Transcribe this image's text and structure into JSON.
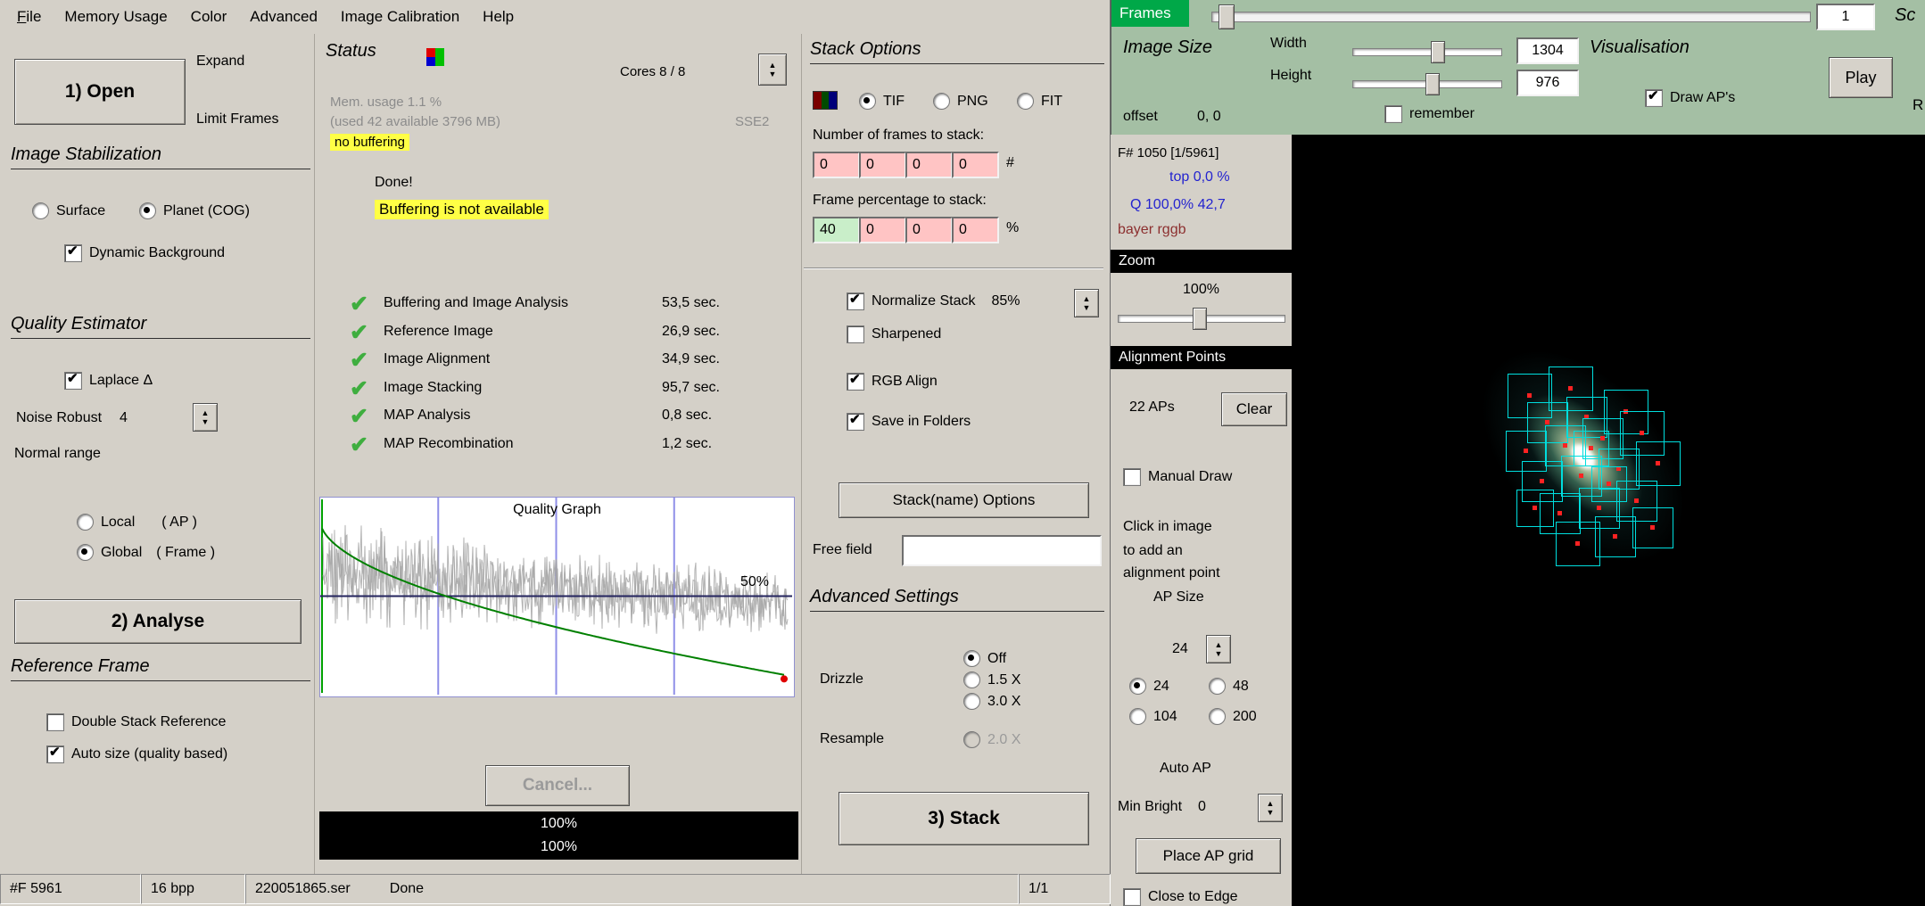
{
  "colors": {
    "window_bg": "#d4d0c8",
    "viewer_header_green": "#a4bfa4",
    "frames_badge_green": "#00a848",
    "highlight_yellow": "#ffff45",
    "info_blue": "#2323cf",
    "bayer_red": "#8c2f2f",
    "ap_box_cyan": "#00dede",
    "ap_dot_red": "#ff2222"
  },
  "menu": {
    "items": [
      "File",
      "Memory Usage",
      "Color",
      "Advanced",
      "Image Calibration",
      "Help"
    ]
  },
  "left": {
    "open": "1) Open",
    "expand": "Expand",
    "limit": "Limit Frames",
    "stab_title": "Image Stabilization",
    "surface": "Surface",
    "planet": "Planet (COG)",
    "dyn_bg": "Dynamic Background",
    "qe_title": "Quality Estimator",
    "laplace": "Laplace Δ",
    "noise_label": "Noise Robust",
    "noise_value": "4",
    "normal_range": "Normal range",
    "local": "Local",
    "local_sub": "( AP )",
    "global": "Global",
    "global_sub": "( Frame )",
    "analyse": "2) Analyse",
    "ref_title": "Reference Frame",
    "double_stack": "Double Stack Reference",
    "auto_size": "Auto size (quality based)"
  },
  "status": {
    "title": "Status",
    "cores": "Cores 8 / 8",
    "mem": "Mem. usage 1.1 %",
    "mem2": "(used 42 available 3796 MB)",
    "nobuf": "no buffering",
    "sse": "SSE2",
    "done": "Done!",
    "bufna": "Buffering is not available",
    "tasks": [
      {
        "label": "Buffering and Image Analysis",
        "time": "53,5 sec."
      },
      {
        "label": "Reference Image",
        "time": "26,9 sec."
      },
      {
        "label": "Image Alignment",
        "time": "34,9 sec."
      },
      {
        "label": "Image Stacking",
        "time": "95,7 sec."
      },
      {
        "label": "MAP Analysis",
        "time": "0,8 sec."
      },
      {
        "label": "MAP Recombination",
        "time": "1,2 sec."
      }
    ],
    "graph_title": "Quality Graph",
    "half": "50%",
    "cancel": "Cancel...",
    "p1": "100%",
    "p2": "100%"
  },
  "stack": {
    "title": "Stack Options",
    "fmt_tif": "TIF",
    "fmt_png": "PNG",
    "fmt_fit": "FIT",
    "frames_label": "Number of frames to stack:",
    "frames_values": [
      "0",
      "0",
      "0",
      "0"
    ],
    "frames_unit": "#",
    "pct_label": "Frame percentage to stack:",
    "pct_values": [
      "40",
      "0",
      "0",
      "0"
    ],
    "pct_unit": "%",
    "normalize": "Normalize Stack",
    "normalize_value": "85%",
    "sharpened": "Sharpened",
    "rgb_align": "RGB Align",
    "save_folders": "Save in Folders",
    "stackname_btn": "Stack(name) Options",
    "free_field": "Free field",
    "free_field_value": "",
    "adv_title": "Advanced Settings",
    "drizzle_label": "Drizzle",
    "drizzle_off": "Off",
    "drizzle_15": "1.5 X",
    "drizzle_30": "3.0 X",
    "resample_label": "Resample",
    "resample_20": "2.0 X",
    "stack_btn": "3) Stack"
  },
  "bar": {
    "frames": "#F 5961",
    "bpp": "16 bpp",
    "file": "220051865.ser",
    "state": "Done",
    "page": "1/1"
  },
  "viewer": {
    "frames_label": "Frames",
    "frames_value": "1",
    "sc_partial": "Sc",
    "r_partial": "R",
    "image_size_title": "Image Size",
    "width_label": "Width",
    "width_value": "1304",
    "height_label": "Height",
    "height_value": "976",
    "offset_label": "offset",
    "offset_value": "0, 0",
    "remember": "remember",
    "visualisation_title": "Visualisation",
    "play_btn": "Play",
    "draw_aps": "Draw AP's",
    "frame_info": "F# 1050 [1/5961]",
    "top_info": "top 0,0 %",
    "q_info": "Q 100,0%  42,7",
    "bayer": "bayer rggb",
    "zoom_title": "Zoom",
    "zoom_value": "100%",
    "ap_title": "Alignment Points",
    "ap_count": "22 APs",
    "clear_btn": "Clear",
    "manual_draw": "Manual Draw",
    "hint1": "Click in image",
    "hint2": "to add an",
    "hint3": "alignment point",
    "ap_size_label": "AP Size",
    "ap_size_value": "24",
    "size_24": "24",
    "size_48": "48",
    "size_104": "104",
    "size_200": "200",
    "auto_ap": "Auto AP",
    "min_bright_label": "Min Bright",
    "min_bright_value": "0",
    "place_grid_btn": "Place AP grid",
    "close_edge": "Close to Edge",
    "ap_boxes": [
      [
        242,
        268,
        48
      ],
      [
        288,
        260,
        48
      ],
      [
        264,
        300,
        44
      ],
      [
        308,
        294,
        44
      ],
      [
        350,
        286,
        48
      ],
      [
        240,
        332,
        44
      ],
      [
        284,
        326,
        44
      ],
      [
        326,
        318,
        44
      ],
      [
        368,
        310,
        48
      ],
      [
        258,
        366,
        44
      ],
      [
        302,
        360,
        44
      ],
      [
        344,
        352,
        44
      ],
      [
        386,
        344,
        48
      ],
      [
        278,
        402,
        44
      ],
      [
        322,
        396,
        44
      ],
      [
        364,
        388,
        44
      ],
      [
        296,
        434,
        48
      ],
      [
        340,
        428,
        44
      ],
      [
        252,
        398,
        40
      ],
      [
        382,
        418,
        44
      ],
      [
        316,
        332,
        38
      ],
      [
        336,
        372,
        38
      ]
    ]
  }
}
